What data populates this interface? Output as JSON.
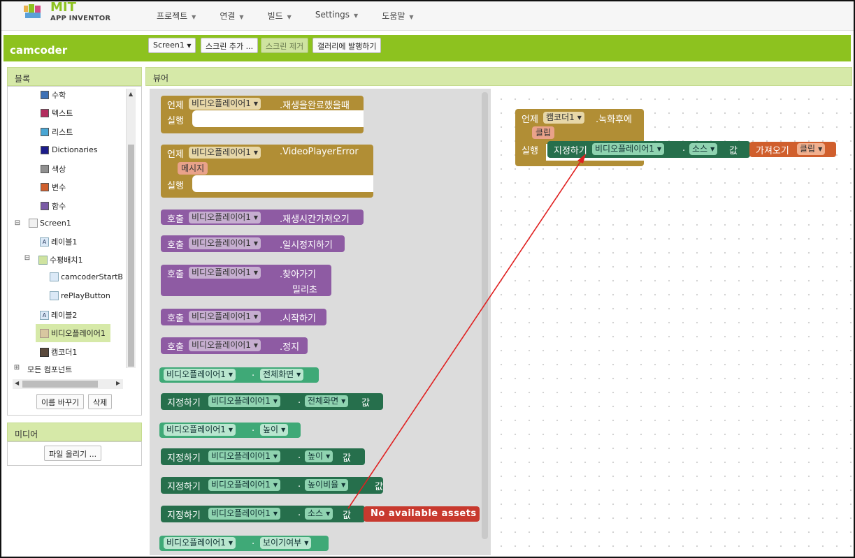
{
  "logo": {
    "mit": "MIT",
    "sub": "APP INVENTOR"
  },
  "menu": [
    {
      "label": "프로젝트"
    },
    {
      "label": "연결"
    },
    {
      "label": "빌드"
    },
    {
      "label": "Settings"
    },
    {
      "label": "도움말"
    }
  ],
  "project": {
    "name": "camcoder",
    "screen_select": "Screen1",
    "add_screen": "스크린 추가 ...",
    "remove_screen": "스크린 제거",
    "publish": "갤러리에 발행하기"
  },
  "blocks_panel": {
    "title": "블록",
    "builtins": [
      "수학",
      "텍스트",
      "리스트",
      "Dictionaries",
      "색상",
      "변수",
      "함수"
    ],
    "builtin_colors": [
      "#3f71b5",
      "#b32d5e",
      "#49a6d4",
      "#1c1c8a",
      "#909090",
      "#d05f2d",
      "#7b5ba6"
    ],
    "tree": {
      "screen": "Screen1",
      "label1": "레이블1",
      "hlayout": "수평배치1",
      "start_btn": "camcoderStartB",
      "replay_btn": "rePlayButton",
      "label2": "레이블2",
      "videoplayer": "비디오플레이어1",
      "camcorder": "캠코더1",
      "all_components": "모든 컴포넌트"
    },
    "rename": "이름 바꾸기",
    "delete": "삭제"
  },
  "media_panel": {
    "title": "미디어",
    "upload": "파일 올리기 ..."
  },
  "viewer": {
    "title": "뷰어"
  },
  "words": {
    "when": "언제",
    "do": "실행",
    "call": "호출",
    "set": "지정하기",
    "to": "값",
    "get": "가져오기",
    "dot": "."
  },
  "flyout_blocks": {
    "component": "비디오플레이어1",
    "completed": ".재생을완료했을때",
    "error": ".VideoPlayerError",
    "error_param": "메시지",
    "getduration": ".재생시간가져오기",
    "pause": ".일시정지하기",
    "seekto": ".찾아가기",
    "ms": "밀리초",
    "start": ".시작하기",
    "stop": ".정지",
    "fullscreen": "전체화면",
    "height": "높이",
    "height_pct": "높이비율",
    "source": "소스",
    "visible": "보이기여부",
    "no_assets": "No available assets"
  },
  "workspace_block": {
    "component": "캠코더1",
    "event": ".녹화후에",
    "param": "클립",
    "set_component": "비디오플레이어1",
    "property": "소스",
    "get_var": "클립"
  }
}
